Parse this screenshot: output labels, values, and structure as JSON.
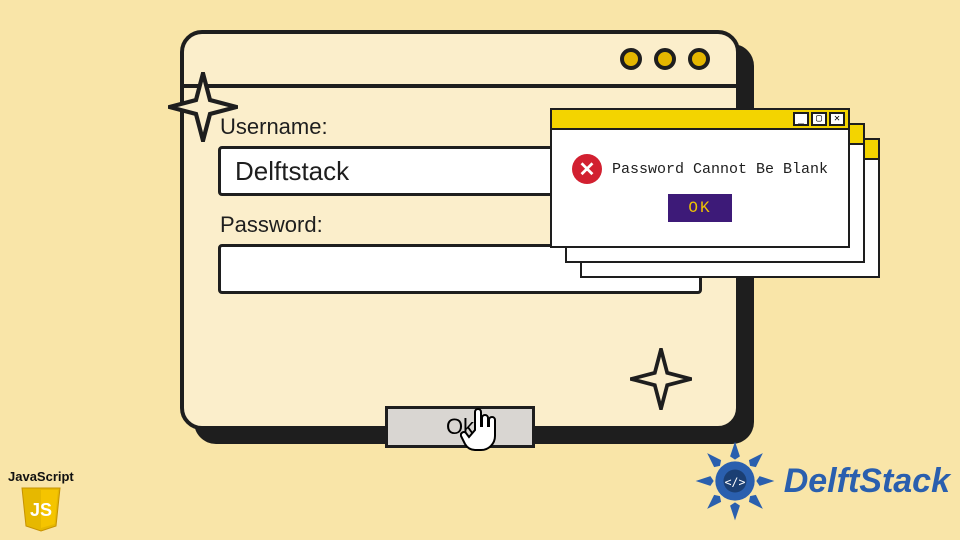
{
  "window": {
    "dots": 3
  },
  "form": {
    "username_label": "Username:",
    "username_value": "Delftstack",
    "password_label": "Password:",
    "password_value": "",
    "submit_label": "Ok"
  },
  "popup": {
    "message": "Password Cannot Be Blank",
    "ok_label": "OK",
    "titlebar": {
      "minimize": "_",
      "maximize": "▢",
      "close": "✕"
    }
  },
  "icons": {
    "error": "✕",
    "cursor": "hand-pointer"
  },
  "logos": {
    "js_label": "JavaScript",
    "js_badge": "JS",
    "delft_label": "DelftStack"
  },
  "colors": {
    "bg": "#f9e5a8",
    "panel": "#fbeecb",
    "outline": "#1e1e1e",
    "accent_yellow": "#e4b600",
    "popup_title": "#f3d400",
    "error_red": "#d22030",
    "popup_ok_bg": "#3d1a78",
    "popup_ok_fg": "#f0c400",
    "delft_blue": "#2a5fae"
  }
}
